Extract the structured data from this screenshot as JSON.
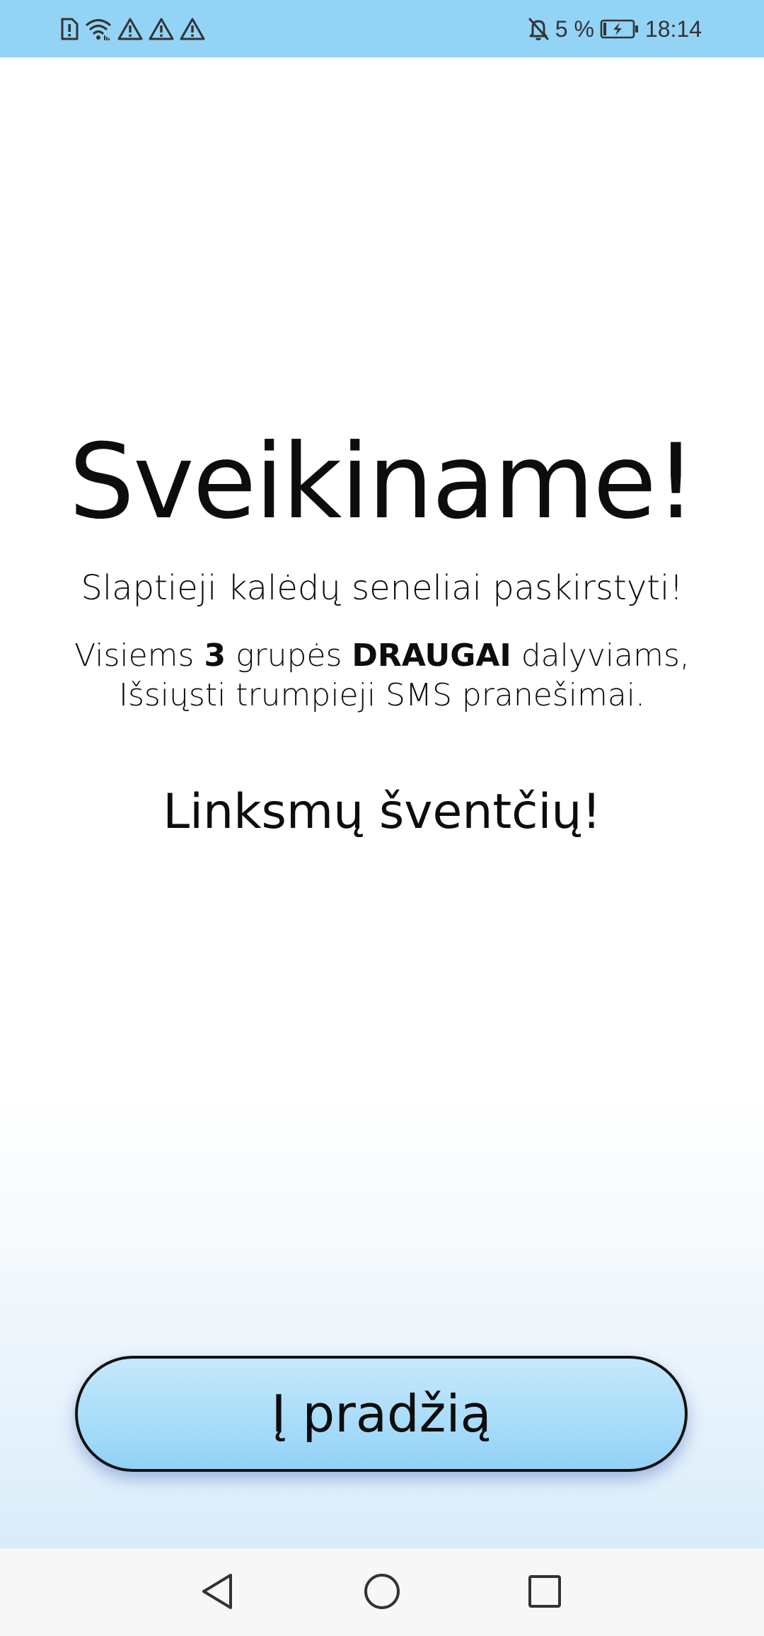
{
  "status_bar": {
    "icons_left": [
      "sim-alert-icon",
      "wifi-icon",
      "warning-icon",
      "warning-icon",
      "warning-icon"
    ],
    "icons_right": [
      "notifications-off-icon",
      "battery-charging-icon"
    ],
    "battery_text": "5 %",
    "time": "18:14",
    "background_color": "#93d3f6"
  },
  "main": {
    "title": "Sveikiname!",
    "subtitle": "Slaptieji kalėdų seneliai paskirstyti!",
    "message": {
      "prefix": "Visiems ",
      "count": "3",
      "middle": " grupės ",
      "group_name": "DRAUGAI",
      "suffix": " dalyviams,",
      "line2": "Išsiųsti trumpieji SMS pranešimai."
    },
    "greeting": "Linksmų šventčių!"
  },
  "actions": {
    "home_button_label": "Į pradžią",
    "button_color": "#a7dcfa"
  },
  "nav_bar": {
    "icons": [
      "back-icon",
      "home-icon",
      "recent-apps-icon"
    ]
  }
}
